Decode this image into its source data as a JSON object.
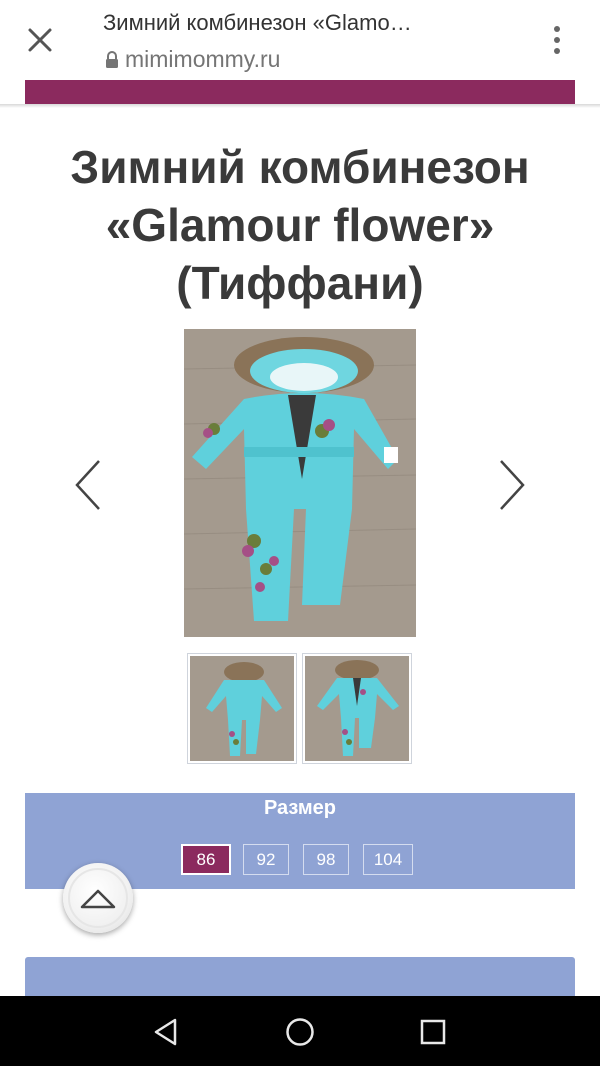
{
  "browser": {
    "page_title": "Зимний комбинезон «Glamo…",
    "url": "mimimommy.ru",
    "icons": {
      "close": "close-icon",
      "lock": "lock-icon",
      "menu": "more-vert-icon"
    }
  },
  "colors": {
    "brand": "#8b2a5e",
    "panel": "#8fa3d4",
    "jumpsuit": "#5fd0dc",
    "floor": "#a49a8e"
  },
  "product": {
    "title": "Зимний комбинезон «Glamour flower» (Тиффани)",
    "title_lines": [
      "Зимний комбинезон",
      "«Glamour flower»",
      "(Тиффани)"
    ],
    "gallery": {
      "prev_icon": "chevron-left-icon",
      "next_icon": "chevron-right-icon",
      "thumbnail_count": 2,
      "active_thumbnail": 2
    }
  },
  "size_selector": {
    "label": "Размер",
    "options": [
      "86",
      "92",
      "98",
      "104"
    ],
    "selected": "86"
  },
  "scroll_top": {
    "icon": "chevron-up-icon"
  },
  "android_nav": {
    "back": "back-icon",
    "home": "home-icon",
    "recents": "recents-icon"
  }
}
